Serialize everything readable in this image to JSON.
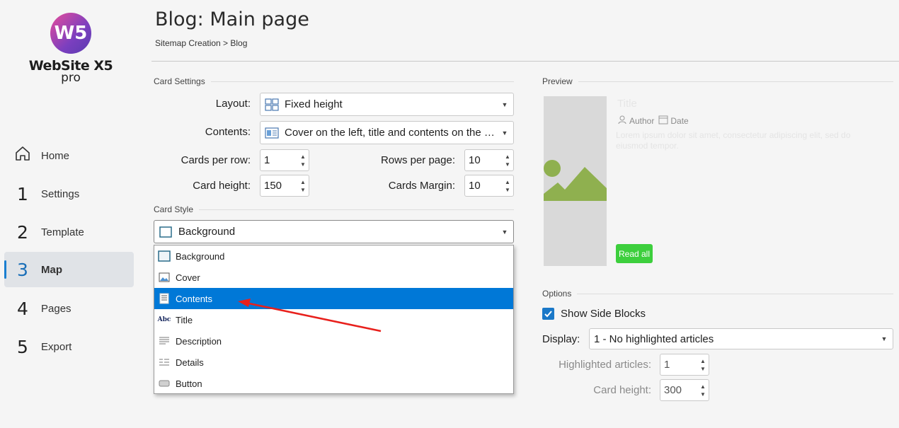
{
  "app": {
    "logo_text": "W5",
    "name": "WebSite X5",
    "edition": "pro"
  },
  "nav": [
    {
      "num": "",
      "label": "Home"
    },
    {
      "num": "1",
      "label": "Settings"
    },
    {
      "num": "2",
      "label": "Template"
    },
    {
      "num": "3",
      "label": "Map",
      "active": true
    },
    {
      "num": "4",
      "label": "Pages"
    },
    {
      "num": "5",
      "label": "Export"
    }
  ],
  "header": {
    "title": "Blog: Main page",
    "breadcrumb": "Sitemap Creation > Blog"
  },
  "card_settings": {
    "section_title": "Card Settings",
    "layout_label": "Layout:",
    "layout_value": "Fixed height",
    "contents_label": "Contents:",
    "contents_value": "Cover on the left, title and contents on the right",
    "cards_per_row_label": "Cards per row:",
    "cards_per_row_value": "1",
    "rows_per_page_label": "Rows per page:",
    "rows_per_page_value": "10",
    "card_height_label": "Card height:",
    "card_height_value": "150",
    "cards_margin_label": "Cards Margin:",
    "cards_margin_value": "10"
  },
  "card_style": {
    "section_title": "Card Style",
    "selected": "Background",
    "options": [
      "Background",
      "Cover",
      "Contents",
      "Title",
      "Description",
      "Details",
      "Button"
    ],
    "highlighted": "Contents"
  },
  "preview": {
    "section_title": "Preview",
    "title": "Title",
    "author": "Author",
    "date": "Date",
    "lorem": "Lorem ipsum dolor sit amet, consectetur adipiscing elit, sed do eiusmod tempor.",
    "button": "Read all"
  },
  "options": {
    "section_title": "Options",
    "show_side_blocks_label": "Show Side Blocks",
    "show_side_blocks_checked": true,
    "display_label": "Display:",
    "display_value": "1 - No highlighted articles",
    "highlighted_label": "Highlighted articles:",
    "highlighted_value": "1",
    "card_height_label": "Card height:",
    "card_height_value": "300"
  },
  "colors": {
    "accent": "#0078d7",
    "read_all": "#3dcf3d",
    "image": "#8fb04f",
    "annotation_arrow": "#e8201c"
  }
}
